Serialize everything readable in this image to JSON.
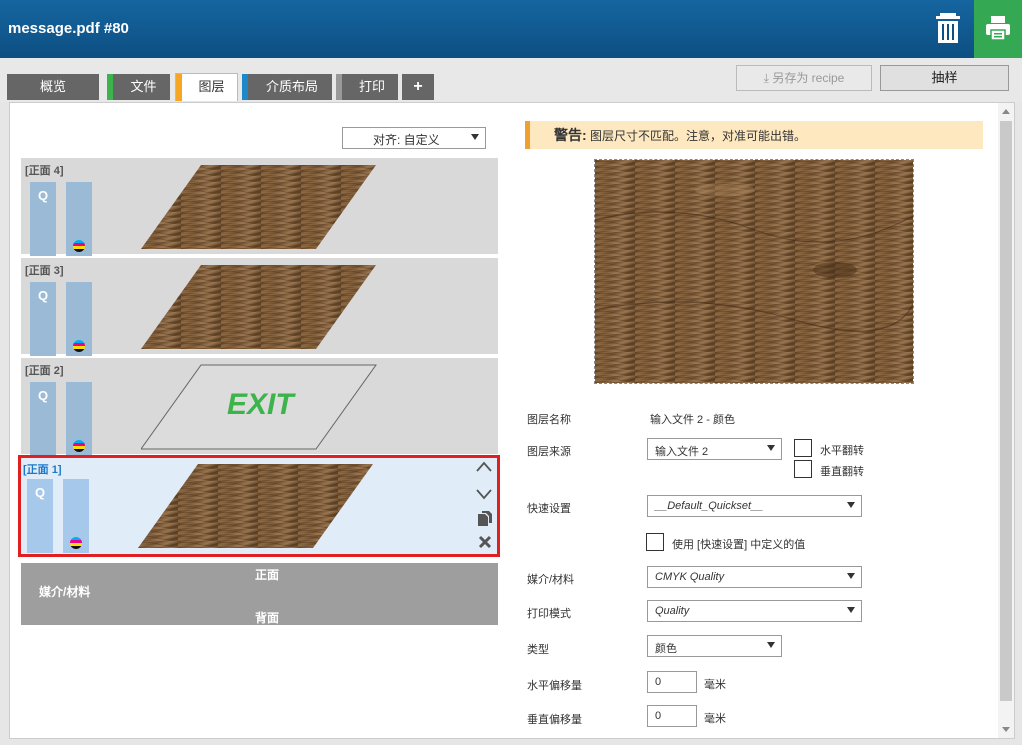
{
  "window": {
    "title": "message.pdf #80"
  },
  "icons": {
    "trash": "trash-icon",
    "print": "printer-icon",
    "download": "download-icon"
  },
  "colors": {
    "titlebar": "#0d4f82",
    "print": "#34a853",
    "warning_border": "#f0a030",
    "selection": "#e02020",
    "exit_text": "#3cb44b"
  },
  "tabs": [
    {
      "label": "概览",
      "color": ""
    },
    {
      "label": "文件",
      "color": "#3cb44b"
    },
    {
      "label": "图层",
      "color": "#f5a623"
    },
    {
      "label": "介质布局",
      "color": "#1e88c8"
    },
    {
      "label": "打印",
      "color": "#999999"
    },
    {
      "label": "+",
      "color": ""
    }
  ],
  "toolbar": {
    "save_recipe": "另存为 recipe",
    "sample": "抽样"
  },
  "align": {
    "value": "对齐: 自定义"
  },
  "layers": [
    {
      "name": "[正面 4]",
      "q": "Q",
      "kind": "wood"
    },
    {
      "name": "[正面 3]",
      "q": "Q",
      "kind": "wood"
    },
    {
      "name": "[正面 2]",
      "q": "Q",
      "kind": "exit",
      "exit_text": "EXIT"
    },
    {
      "name": "[正面 1]",
      "q": "Q",
      "kind": "wood",
      "selected": true
    }
  ],
  "media_bar": {
    "front": "正面",
    "media": "媒介/材料",
    "back": "背面"
  },
  "warning": {
    "label": "警告:",
    "text": " 图层尺寸不匹配。注意，对准可能出错。"
  },
  "props": {
    "layer_name_label": "图层名称",
    "layer_name_value": "输入文件 2 - 颜色",
    "source_label": "图层来源",
    "source_value": "输入文件 2",
    "flip_h": "水平翻转",
    "flip_v": "垂直翻转",
    "quickset_label": "快速设置",
    "quickset_value": "__Default_Quickset__",
    "use_quickset": "使用 [快速设置] 中定义的值",
    "media_label": "媒介/材料",
    "media_value": "CMYK Quality",
    "mode_label": "打印模式",
    "mode_value": "Quality",
    "type_label": "类型",
    "type_value": "颜色",
    "hoff_label": "水平偏移量",
    "hoff_value": "0",
    "hoff_unit": "毫米",
    "voff_label": "垂直偏移量",
    "voff_value": "0",
    "voff_unit": "毫米"
  }
}
